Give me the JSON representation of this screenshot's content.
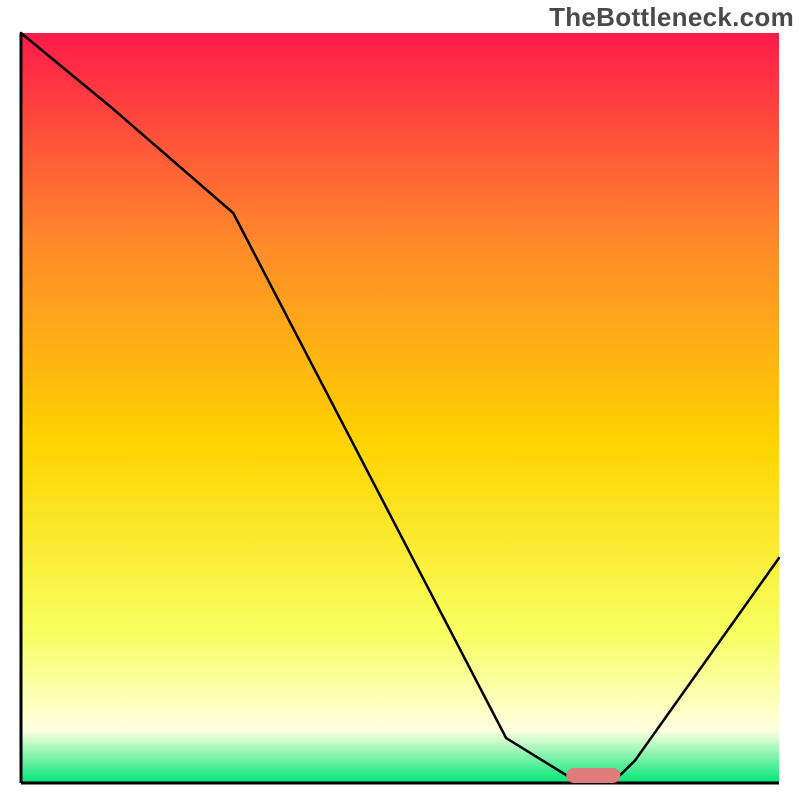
{
  "watermark": "TheBottleneck.com",
  "colors": {
    "curve": "#000000",
    "marker_fill": "#de7b7b",
    "marker_stroke": "#de7b7b",
    "axis": "#000000",
    "grad_top": "#ff1a4a",
    "grad_mid_upper": "#ff8a2a",
    "grad_mid": "#ffd400",
    "grad_mid_lower": "#f7ff60",
    "grad_near_bottom": "#ffffe0",
    "grad_bottom": "#00e676"
  },
  "chart_data": {
    "type": "line",
    "title": "",
    "xlabel": "",
    "ylabel": "",
    "xlim": [
      0,
      100
    ],
    "ylim": [
      0,
      100
    ],
    "series": [
      {
        "name": "bottleneck-curve",
        "x": [
          0,
          12,
          28,
          64,
          72,
          79,
          81,
          100
        ],
        "y": [
          100,
          90,
          76,
          6,
          1,
          1,
          3,
          30
        ]
      }
    ],
    "marker": {
      "name": "optimal-range",
      "x_start": 72,
      "x_end": 79,
      "y": 1
    },
    "gradient_stops": [
      {
        "offset": 0,
        "key": "grad_top"
      },
      {
        "offset": 28,
        "key": "grad_mid_upper"
      },
      {
        "offset": 55,
        "key": "grad_mid"
      },
      {
        "offset": 80,
        "key": "grad_mid_lower"
      },
      {
        "offset": 93,
        "key": "grad_near_bottom"
      },
      {
        "offset": 100,
        "key": "grad_bottom"
      }
    ]
  }
}
